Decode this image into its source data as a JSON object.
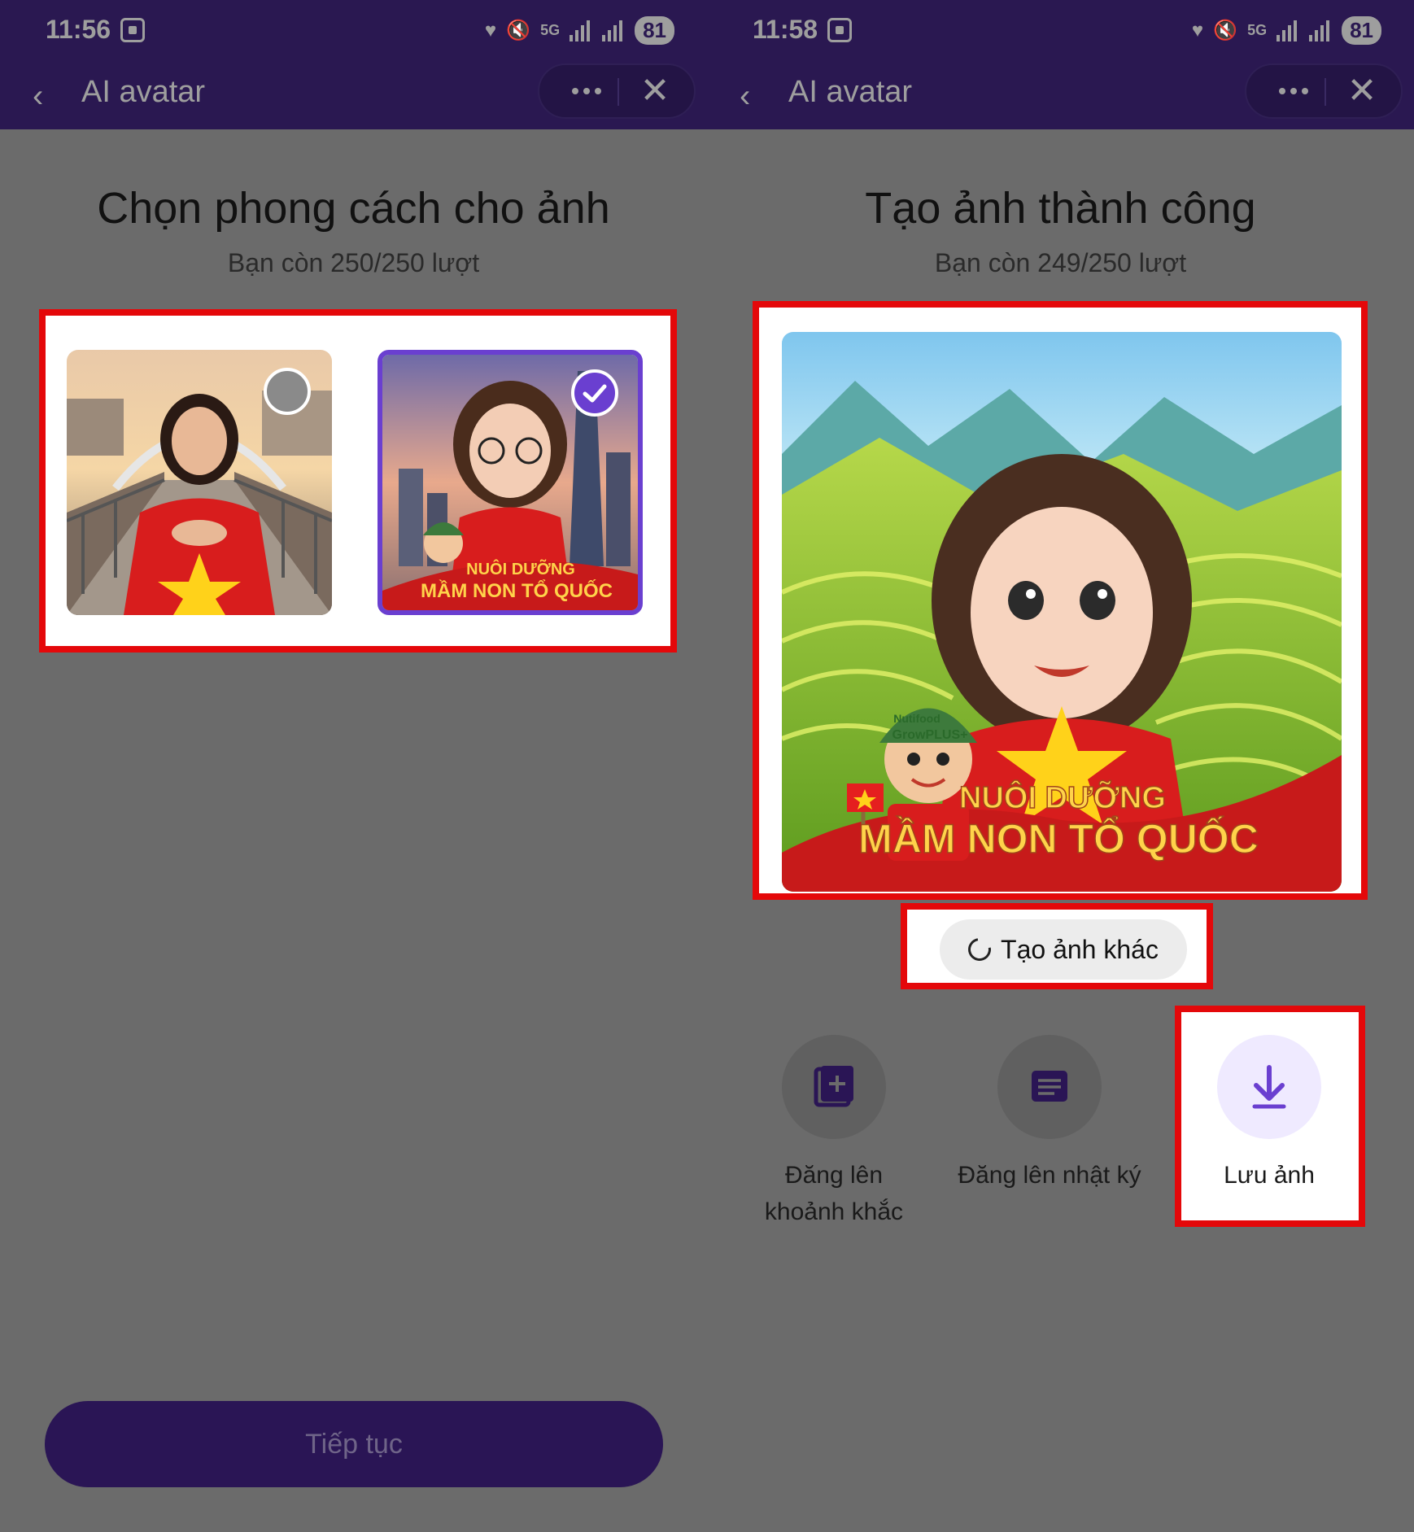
{
  "left": {
    "status": {
      "time": "11:56",
      "battery": "81",
      "network": "5G"
    },
    "appbar": {
      "title": "AI avatar"
    },
    "heading": "Chọn phong cách cho ảnh",
    "subtitle": "Bạn còn 250/250 lượt",
    "options": [
      {
        "name": "original-photo",
        "selected": false
      },
      {
        "name": "nuoi-duong-mam-non-to-quoc-style",
        "selected": true,
        "banner_top": "NUÔI DƯỠNG",
        "banner_bottom": "MẦM NON TỔ QUỐC",
        "brand": "GrowPLUS+"
      }
    ],
    "continue_label": "Tiếp tục"
  },
  "right": {
    "status": {
      "time": "11:58",
      "battery": "81",
      "network": "5G"
    },
    "appbar": {
      "title": "AI avatar"
    },
    "heading": "Tạo ảnh thành công",
    "subtitle": "Bạn còn 249/250 lượt",
    "result": {
      "banner_top": "NUÔI DƯỠNG",
      "banner_bottom": "MẦM NON TỔ QUỐC",
      "brand_small": "Nutifood",
      "brand": "GrowPLUS+"
    },
    "regen_label": "Tạo ảnh khác",
    "actions": [
      {
        "name": "post-moment",
        "label": "Đăng lên khoảnh khắc",
        "icon": "add-photo-icon"
      },
      {
        "name": "post-diary",
        "label": "Đăng lên nhật ký",
        "icon": "diary-icon"
      },
      {
        "name": "save-image",
        "label": "Lưu ảnh",
        "icon": "download-icon"
      }
    ]
  },
  "colors": {
    "accent": "#2a1555",
    "highlight": "#e4080a",
    "selected": "#6a3fd0"
  }
}
